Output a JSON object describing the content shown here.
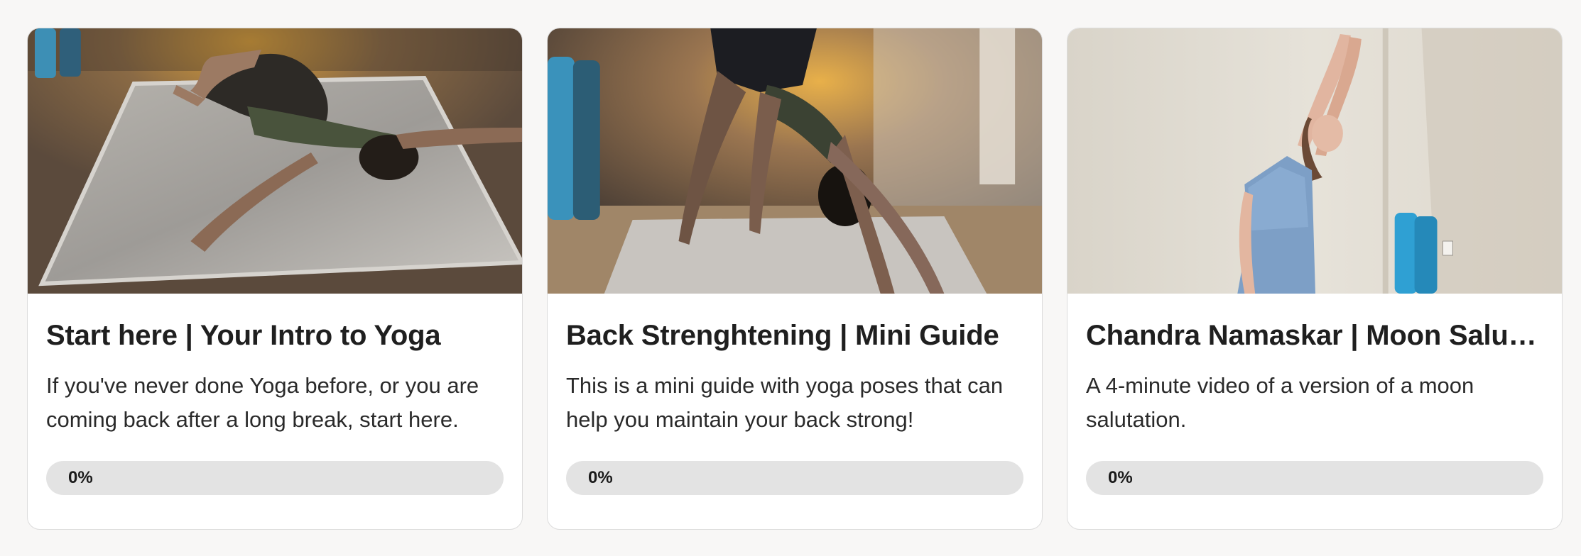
{
  "courses": [
    {
      "title": "Start here | Your Intro to Yoga",
      "description": "If you've never done Yoga before, or you are coming back after a long break, start here.",
      "progress": 0,
      "progress_label": "0%",
      "image": "woman-lying-twist-pose-on-mat"
    },
    {
      "title": "Back Strenghtening | Mini Guide",
      "description": "This is a mini guide with yoga poses that can help you maintain your back strong!",
      "progress": 0,
      "progress_label": "0%",
      "image": "woman-downward-dog-pose-on-mat"
    },
    {
      "title": "Chandra Namaskar | Moon Salutation",
      "description": "A 4-minute video of a version of a moon salutation.",
      "progress": 0,
      "progress_label": "0%",
      "image": "woman-standing-arms-raised-stretch"
    }
  ],
  "colors": {
    "page_background": "#f8f7f6",
    "card_background": "#ffffff",
    "card_border": "#dcdcdc",
    "progress_track": "#e3e3e3",
    "text_primary": "#1f1f1f"
  }
}
